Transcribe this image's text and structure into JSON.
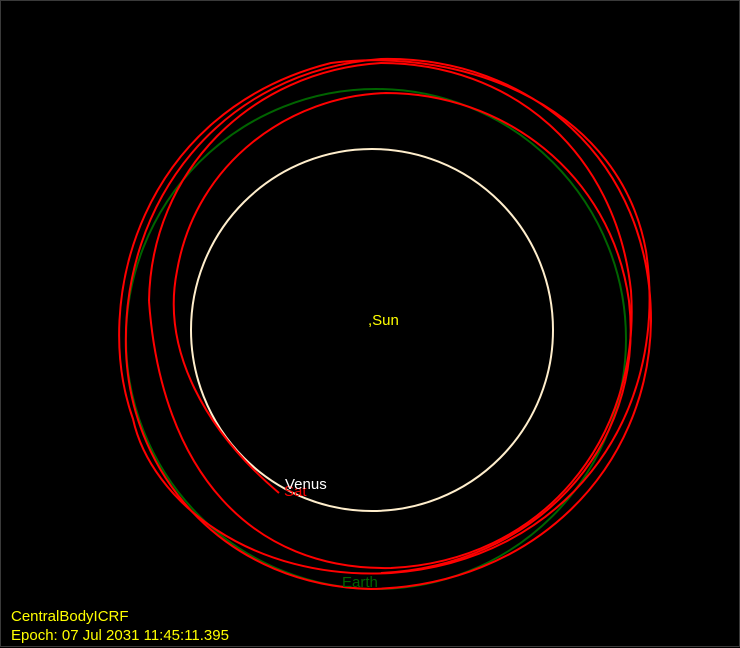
{
  "view": {
    "background": "#000000",
    "central_body_label": "CentralBodyICRF",
    "epoch_label": "Epoch: 07 Jul 2031 11:45:11.395",
    "hud_color": "#ffff00"
  },
  "bodies": {
    "sun": {
      "label": ",Sun",
      "color": "#ffff00"
    },
    "venus": {
      "label": "Venus",
      "color": "#ffffff",
      "orbit_color": "#ffeecc"
    },
    "earth": {
      "label": "Earth",
      "color": "#006400",
      "orbit_color": "#006400"
    },
    "spacecraft": {
      "label": "Sat",
      "color": "#ff0000",
      "trajectory_color": "#ff0000"
    }
  }
}
